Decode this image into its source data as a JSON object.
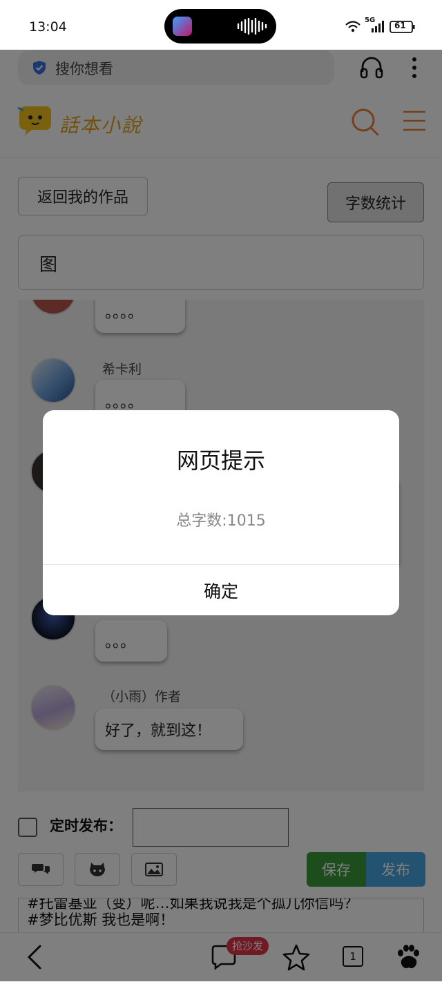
{
  "status_bar": {
    "time": "13:04",
    "network": "5G",
    "battery": "61"
  },
  "browser": {
    "search_placeholder": "搜你想看"
  },
  "site": {
    "logo_text": "話本小說"
  },
  "toolbar": {
    "back_label": "返回我的作品",
    "word_count_label": "字数统计"
  },
  "title_field": {
    "value": "图"
  },
  "messages": [
    {
      "name": "",
      "text": "。。。。"
    },
    {
      "name": "希卡利",
      "text": "。。。。"
    },
    {
      "name": "",
      "text": "。。。"
    },
    {
      "name": "（小雨）作者",
      "text": "好了，就到这！"
    }
  ],
  "schedule": {
    "label": "定时发布：",
    "value": ""
  },
  "actions": {
    "save_label": "保存",
    "publish_label": "发布"
  },
  "editor": {
    "line1": "#托雷基亚（变）呢…如果我说我是个孤儿你信吗？",
    "line2": "#梦比优斯 我也是啊！"
  },
  "nav": {
    "comment_badge": "抢沙发",
    "tab_count": "1"
  },
  "dialog": {
    "title": "网页提示",
    "message": "总字数:1015",
    "ok_label": "确定"
  },
  "colors": {
    "accent_orange": "#e8833a",
    "save_green": "#3a9b3a",
    "publish_blue": "#46a6e0",
    "badge_red": "#e0354b"
  }
}
